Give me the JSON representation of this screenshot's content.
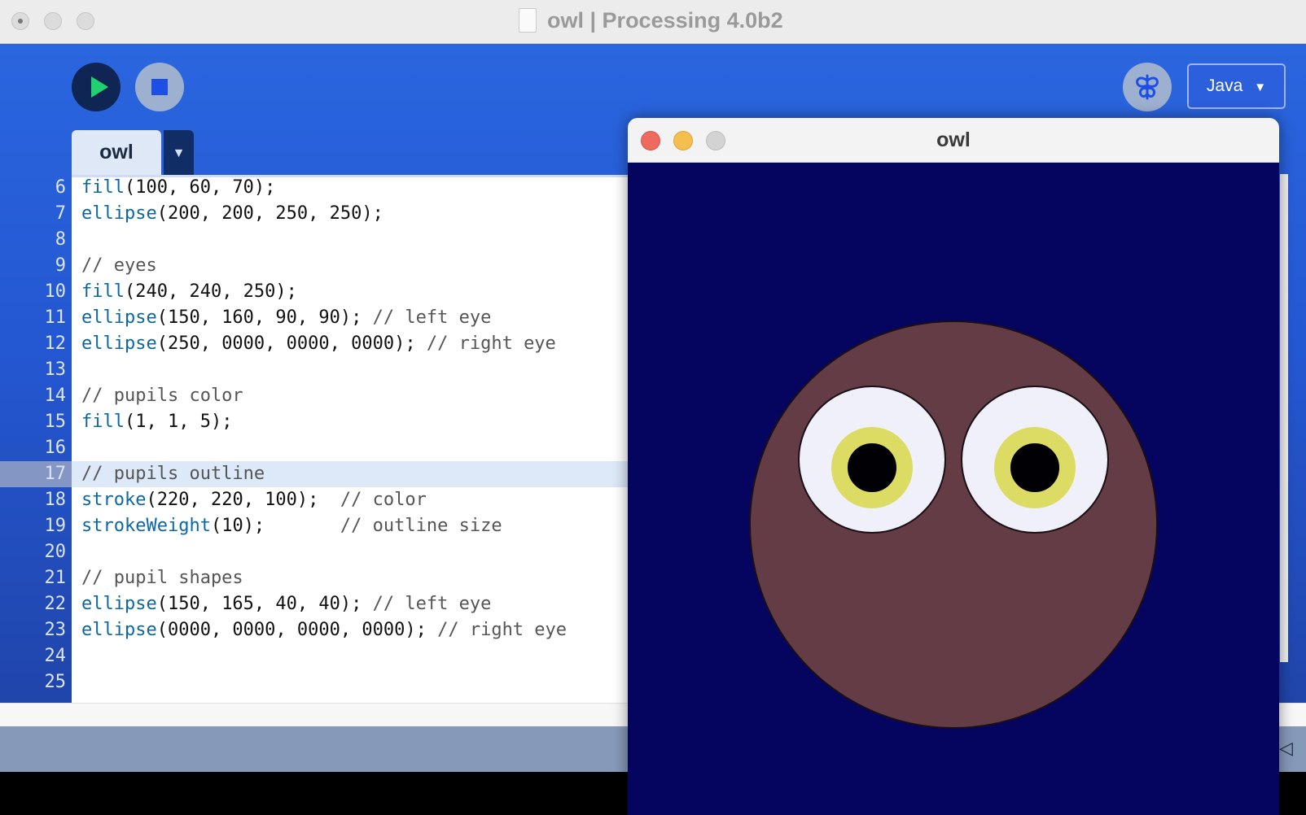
{
  "window": {
    "title": "owl | Processing 4.0b2"
  },
  "toolbar": {
    "mode": "Java",
    "mode_arrow": "▼"
  },
  "tabs": [
    {
      "label": "owl"
    }
  ],
  "tab_menu_arrow": "▼",
  "editor": {
    "highlighted_line": 17,
    "lines": [
      {
        "num": "6",
        "parts": [
          {
            "t": "fill",
            "c": "fn"
          },
          {
            "t": "(100, 60, 70);"
          }
        ]
      },
      {
        "num": "7",
        "parts": [
          {
            "t": "ellipse",
            "c": "fn"
          },
          {
            "t": "(200, 200, 250, 250);"
          }
        ]
      },
      {
        "num": "8",
        "parts": []
      },
      {
        "num": "9",
        "parts": [
          {
            "t": "// eyes",
            "c": "cm"
          }
        ]
      },
      {
        "num": "10",
        "parts": [
          {
            "t": "fill",
            "c": "fn"
          },
          {
            "t": "(240, 240, 250);"
          }
        ]
      },
      {
        "num": "11",
        "parts": [
          {
            "t": "ellipse",
            "c": "fn"
          },
          {
            "t": "(150, 160, 90, 90); "
          },
          {
            "t": "// left eye",
            "c": "cm"
          }
        ]
      },
      {
        "num": "12",
        "parts": [
          {
            "t": "ellipse",
            "c": "fn"
          },
          {
            "t": "(250, 0000, 0000, 0000); "
          },
          {
            "t": "// right eye",
            "c": "cm"
          }
        ]
      },
      {
        "num": "13",
        "parts": []
      },
      {
        "num": "14",
        "parts": [
          {
            "t": "// pupils color",
            "c": "cm"
          }
        ]
      },
      {
        "num": "15",
        "parts": [
          {
            "t": "fill",
            "c": "fn"
          },
          {
            "t": "(1, 1, 5);"
          }
        ]
      },
      {
        "num": "16",
        "parts": []
      },
      {
        "num": "17",
        "parts": [
          {
            "t": "// pupils outline",
            "c": "cm"
          }
        ]
      },
      {
        "num": "18",
        "parts": [
          {
            "t": "stroke",
            "c": "fn"
          },
          {
            "t": "(220, 220, 100);  "
          },
          {
            "t": "// color",
            "c": "cm"
          }
        ]
      },
      {
        "num": "19",
        "parts": [
          {
            "t": "strokeWeight",
            "c": "fn"
          },
          {
            "t": "(10);       "
          },
          {
            "t": "// outline size",
            "c": "cm"
          }
        ]
      },
      {
        "num": "20",
        "parts": []
      },
      {
        "num": "21",
        "parts": [
          {
            "t": "// pupil shapes",
            "c": "cm"
          }
        ]
      },
      {
        "num": "22",
        "parts": [
          {
            "t": "ellipse",
            "c": "fn"
          },
          {
            "t": "(150, 165, 40, 40); "
          },
          {
            "t": "// left eye",
            "c": "cm"
          }
        ]
      },
      {
        "num": "23",
        "parts": [
          {
            "t": "ellipse",
            "c": "fn"
          },
          {
            "t": "(0000, 0000, 0000, 0000); "
          },
          {
            "t": "// right eye",
            "c": "cm"
          }
        ]
      },
      {
        "num": "24",
        "parts": []
      },
      {
        "num": "25",
        "parts": []
      }
    ]
  },
  "console": {
    "collapse_icon": "◁"
  },
  "sketch": {
    "title": "owl",
    "colors": {
      "background": "#05055f",
      "body": "#643c46",
      "eye_white": "#f0f0fa",
      "pupil": "#010105",
      "pupil_outline": "#dcdc64"
    }
  }
}
